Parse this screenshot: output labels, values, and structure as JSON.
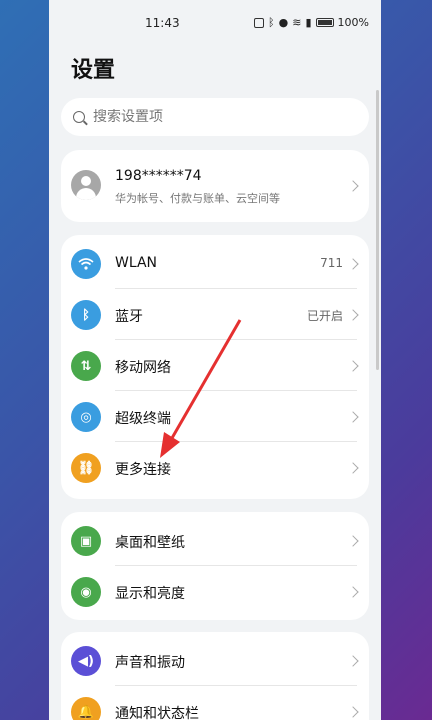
{
  "status": {
    "time": "11:43",
    "battery": "100%"
  },
  "page": {
    "title": "设置"
  },
  "search": {
    "placeholder": "搜索设置项"
  },
  "account": {
    "name": "198******74",
    "desc": "华为帐号、付款与账单、云空间等"
  },
  "group1": [
    {
      "label": "WLAN",
      "value": "711",
      "icon": "wifi-icon",
      "color": "#3a9de0"
    },
    {
      "label": "蓝牙",
      "value": "已开启",
      "icon": "bluetooth-icon",
      "color": "#3a9de0"
    },
    {
      "label": "移动网络",
      "value": "",
      "icon": "mobile-network-icon",
      "color": "#49a84c"
    },
    {
      "label": "超级终端",
      "value": "",
      "icon": "super-device-icon",
      "color": "#3a9de0"
    },
    {
      "label": "更多连接",
      "value": "",
      "icon": "link-icon",
      "color": "#f0a020"
    }
  ],
  "group2": [
    {
      "label": "桌面和壁纸",
      "icon": "wallpaper-icon",
      "color": "#49a84c"
    },
    {
      "label": "显示和亮度",
      "icon": "eye-icon",
      "color": "#49a84c"
    }
  ],
  "group3": [
    {
      "label": "声音和振动",
      "icon": "sound-icon",
      "color": "#5b4fd6"
    },
    {
      "label": "通知和状态栏",
      "icon": "bell-icon",
      "color": "#f0a020"
    }
  ]
}
